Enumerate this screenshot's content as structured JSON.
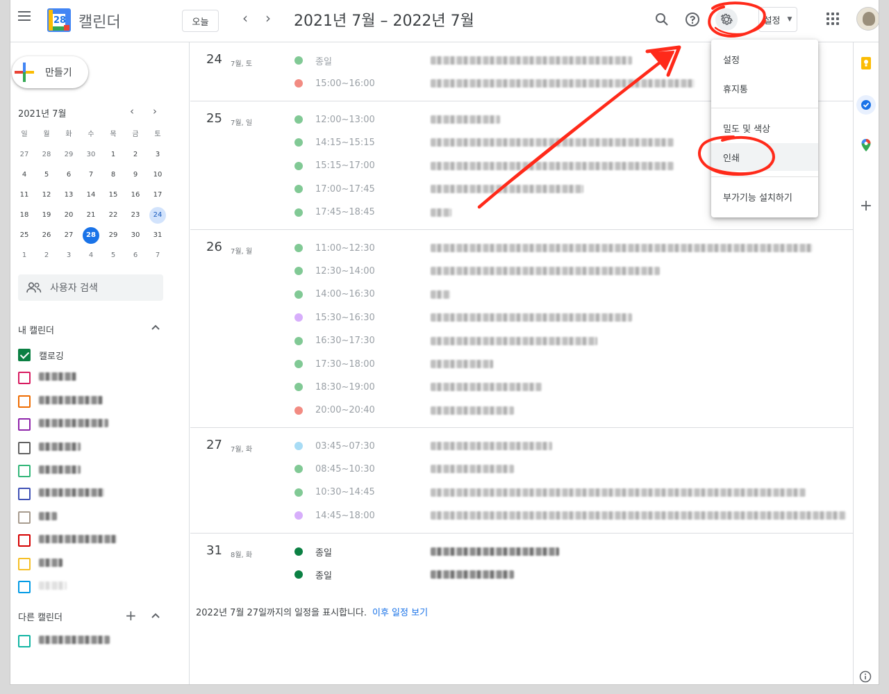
{
  "header": {
    "app_name": "캘린더",
    "logo_day": "28",
    "today_label": "오늘",
    "range_title": "2021년 7월 – 2022년 7월",
    "settings_pill_label": "설정"
  },
  "sidebar": {
    "create_label": "만들기",
    "mini_cal": {
      "title": "2021년 7월",
      "weekdays": [
        "일",
        "월",
        "화",
        "수",
        "목",
        "금",
        "토"
      ],
      "weeks": [
        [
          "27",
          "28",
          "29",
          "30",
          "1",
          "2",
          "3"
        ],
        [
          "4",
          "5",
          "6",
          "7",
          "8",
          "9",
          "10"
        ],
        [
          "11",
          "12",
          "13",
          "14",
          "15",
          "16",
          "17"
        ],
        [
          "18",
          "19",
          "20",
          "21",
          "22",
          "23",
          "24"
        ],
        [
          "25",
          "26",
          "27",
          "28",
          "29",
          "30",
          "31"
        ],
        [
          "1",
          "2",
          "3",
          "4",
          "5",
          "6",
          "7"
        ]
      ]
    },
    "people_search_placeholder": "사용자 검색",
    "my_calendars_title": "내 캘린더",
    "first_calendar_name": "캘로깅",
    "other_calendars_title": "다른 캘린더"
  },
  "schedule": {
    "days": [
      {
        "num": "24",
        "label": "7월, 토",
        "events": [
          {
            "time": "종일",
            "color": "#81c995"
          },
          {
            "time": "15:00~16:00",
            "color": "#f28b82"
          }
        ]
      },
      {
        "num": "25",
        "label": "7월, 일",
        "events": [
          {
            "time": "12:00~13:00",
            "color": "#81c995"
          },
          {
            "time": "14:15~15:15",
            "color": "#81c995"
          },
          {
            "time": "15:15~17:00",
            "color": "#81c995"
          },
          {
            "time": "17:00~17:45",
            "color": "#81c995"
          },
          {
            "time": "17:45~18:45",
            "color": "#81c995"
          }
        ]
      },
      {
        "num": "26",
        "label": "7월, 월",
        "events": [
          {
            "time": "11:00~12:30",
            "color": "#81c995"
          },
          {
            "time": "12:30~14:00",
            "color": "#81c995"
          },
          {
            "time": "14:00~16:30",
            "color": "#81c995"
          },
          {
            "time": "15:30~16:30",
            "color": "#d7aefb"
          },
          {
            "time": "16:30~17:30",
            "color": "#81c995"
          },
          {
            "time": "17:30~18:00",
            "color": "#81c995"
          },
          {
            "time": "18:30~19:00",
            "color": "#81c995"
          },
          {
            "time": "20:00~20:40",
            "color": "#f28b82"
          }
        ]
      },
      {
        "num": "27",
        "label": "7월, 화",
        "events": [
          {
            "time": "03:45~07:30",
            "color": "#a8dcf5"
          },
          {
            "time": "08:45~10:30",
            "color": "#81c995"
          },
          {
            "time": "10:30~14:45",
            "color": "#81c995"
          },
          {
            "time": "14:45~18:00",
            "color": "#d7aefb"
          }
        ]
      },
      {
        "num": "31",
        "label": "8월, 화",
        "events": [
          {
            "time": "종일",
            "color": "#0b8043"
          },
          {
            "time": "종일",
            "color": "#0b8043"
          }
        ]
      }
    ],
    "footnote": "2022년 7월 27일까지의 일정을 표시합니다.",
    "footnote_link": "이후 일정 보기"
  },
  "menu": {
    "items": [
      "설정",
      "휴지통",
      "밀도 및 색상",
      "인쇄",
      "부가기능 설치하기"
    ]
  },
  "colors": {
    "accent": "#1a73e8",
    "annotation": "#ff2a1a",
    "checked_calendar": "#0b8043"
  }
}
